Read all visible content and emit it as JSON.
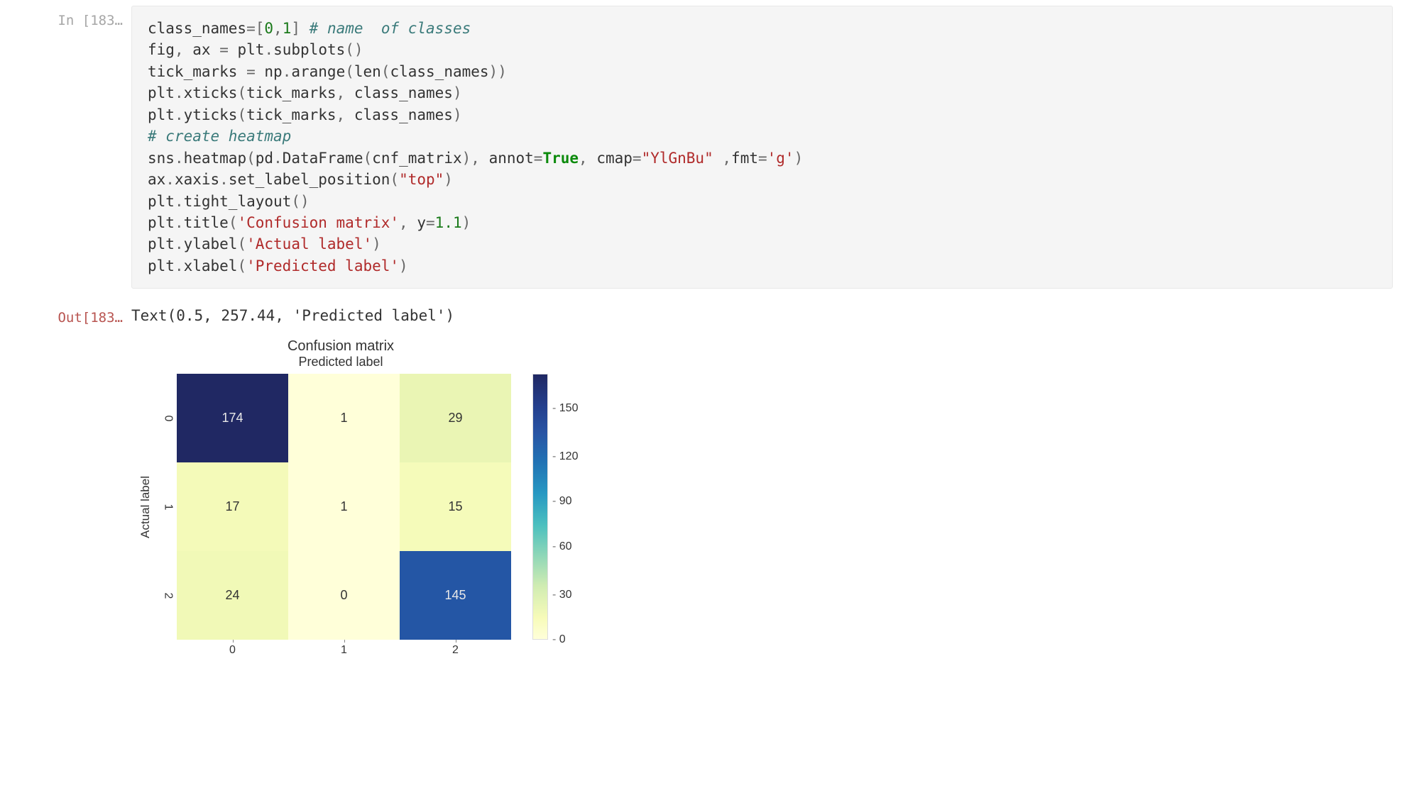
{
  "input_prompt": "In  [183…",
  "output_prompt": "Out[183…",
  "code_tokens": [
    [
      "name",
      "class_names"
    ],
    [
      "op",
      "="
    ],
    [
      "op",
      "["
    ],
    [
      "num",
      "0"
    ],
    [
      "op",
      ","
    ],
    [
      "num",
      "1"
    ],
    [
      "op",
      "]"
    ],
    [
      "plain",
      " "
    ],
    [
      "cmt",
      "# name  of classes"
    ],
    [
      "nl",
      ""
    ],
    [
      "name",
      "fig"
    ],
    [
      "op",
      ","
    ],
    [
      "plain",
      " "
    ],
    [
      "name",
      "ax"
    ],
    [
      "plain",
      " "
    ],
    [
      "op",
      "="
    ],
    [
      "plain",
      " "
    ],
    [
      "name",
      "plt"
    ],
    [
      "op",
      "."
    ],
    [
      "name",
      "subplots"
    ],
    [
      "op",
      "("
    ],
    [
      "op",
      ")"
    ],
    [
      "nl",
      ""
    ],
    [
      "name",
      "tick_marks"
    ],
    [
      "plain",
      " "
    ],
    [
      "op",
      "="
    ],
    [
      "plain",
      " "
    ],
    [
      "name",
      "np"
    ],
    [
      "op",
      "."
    ],
    [
      "name",
      "arange"
    ],
    [
      "op",
      "("
    ],
    [
      "name",
      "len"
    ],
    [
      "op",
      "("
    ],
    [
      "name",
      "class_names"
    ],
    [
      "op",
      ")"
    ],
    [
      "op",
      ")"
    ],
    [
      "nl",
      ""
    ],
    [
      "name",
      "plt"
    ],
    [
      "op",
      "."
    ],
    [
      "name",
      "xticks"
    ],
    [
      "op",
      "("
    ],
    [
      "name",
      "tick_marks"
    ],
    [
      "op",
      ","
    ],
    [
      "plain",
      " "
    ],
    [
      "name",
      "class_names"
    ],
    [
      "op",
      ")"
    ],
    [
      "nl",
      ""
    ],
    [
      "name",
      "plt"
    ],
    [
      "op",
      "."
    ],
    [
      "name",
      "yticks"
    ],
    [
      "op",
      "("
    ],
    [
      "name",
      "tick_marks"
    ],
    [
      "op",
      ","
    ],
    [
      "plain",
      " "
    ],
    [
      "name",
      "class_names"
    ],
    [
      "op",
      ")"
    ],
    [
      "nl",
      ""
    ],
    [
      "cmt",
      "# create heatmap"
    ],
    [
      "nl",
      ""
    ],
    [
      "name",
      "sns"
    ],
    [
      "op",
      "."
    ],
    [
      "name",
      "heatmap"
    ],
    [
      "op",
      "("
    ],
    [
      "name",
      "pd"
    ],
    [
      "op",
      "."
    ],
    [
      "name",
      "DataFrame"
    ],
    [
      "op",
      "("
    ],
    [
      "name",
      "cnf_matrix"
    ],
    [
      "op",
      ")"
    ],
    [
      "op",
      ","
    ],
    [
      "plain",
      " "
    ],
    [
      "name",
      "annot"
    ],
    [
      "op",
      "="
    ],
    [
      "kw",
      "True"
    ],
    [
      "op",
      ","
    ],
    [
      "plain",
      " "
    ],
    [
      "name",
      "cmap"
    ],
    [
      "op",
      "="
    ],
    [
      "str",
      "\"YlGnBu\""
    ],
    [
      "plain",
      " "
    ],
    [
      "op",
      ","
    ],
    [
      "name",
      "fmt"
    ],
    [
      "op",
      "="
    ],
    [
      "str",
      "'g'"
    ],
    [
      "op",
      ")"
    ],
    [
      "nl",
      ""
    ],
    [
      "name",
      "ax"
    ],
    [
      "op",
      "."
    ],
    [
      "name",
      "xaxis"
    ],
    [
      "op",
      "."
    ],
    [
      "name",
      "set_label_position"
    ],
    [
      "op",
      "("
    ],
    [
      "str",
      "\"top\""
    ],
    [
      "op",
      ")"
    ],
    [
      "nl",
      ""
    ],
    [
      "name",
      "plt"
    ],
    [
      "op",
      "."
    ],
    [
      "name",
      "tight_layout"
    ],
    [
      "op",
      "("
    ],
    [
      "op",
      ")"
    ],
    [
      "nl",
      ""
    ],
    [
      "name",
      "plt"
    ],
    [
      "op",
      "."
    ],
    [
      "name",
      "title"
    ],
    [
      "op",
      "("
    ],
    [
      "str",
      "'Confusion matrix'"
    ],
    [
      "op",
      ","
    ],
    [
      "plain",
      " "
    ],
    [
      "name",
      "y"
    ],
    [
      "op",
      "="
    ],
    [
      "num",
      "1.1"
    ],
    [
      "op",
      ")"
    ],
    [
      "nl",
      ""
    ],
    [
      "name",
      "plt"
    ],
    [
      "op",
      "."
    ],
    [
      "name",
      "ylabel"
    ],
    [
      "op",
      "("
    ],
    [
      "str",
      "'Actual label'"
    ],
    [
      "op",
      ")"
    ],
    [
      "nl",
      ""
    ],
    [
      "name",
      "plt"
    ],
    [
      "op",
      "."
    ],
    [
      "name",
      "xlabel"
    ],
    [
      "op",
      "("
    ],
    [
      "str",
      "'Predicted label'"
    ],
    [
      "op",
      ")"
    ]
  ],
  "output_text": "Text(0.5, 257.44, 'Predicted label')",
  "chart_data": {
    "type": "heatmap",
    "title": "Confusion matrix",
    "top_label": "Predicted label",
    "ylabel": "Actual label",
    "x_ticks": [
      "0",
      "1",
      "2"
    ],
    "y_ticks": [
      "0",
      "1",
      "2"
    ],
    "matrix": [
      [
        174,
        1,
        29
      ],
      [
        17,
        1,
        15
      ],
      [
        24,
        0,
        145
      ]
    ],
    "cell_colors": [
      [
        "#202863",
        "#ffffd9",
        "#eaf5b4"
      ],
      [
        "#f4fab9",
        "#ffffd9",
        "#f5fbba"
      ],
      [
        "#f1f9b7",
        "#ffffd9",
        "#2456a5"
      ]
    ],
    "cell_text_colors": [
      [
        "#e8e8e8",
        "#333",
        "#333"
      ],
      [
        "#333",
        "#333",
        "#333"
      ],
      [
        "#333",
        "#333",
        "#e8e8e8"
      ]
    ],
    "colorbar_ticks": [
      {
        "value": "150",
        "pos": 13
      },
      {
        "value": "120",
        "pos": 31
      },
      {
        "value": "90",
        "pos": 48
      },
      {
        "value": "60",
        "pos": 65
      },
      {
        "value": "30",
        "pos": 83
      },
      {
        "value": "0",
        "pos": 100
      }
    ]
  }
}
